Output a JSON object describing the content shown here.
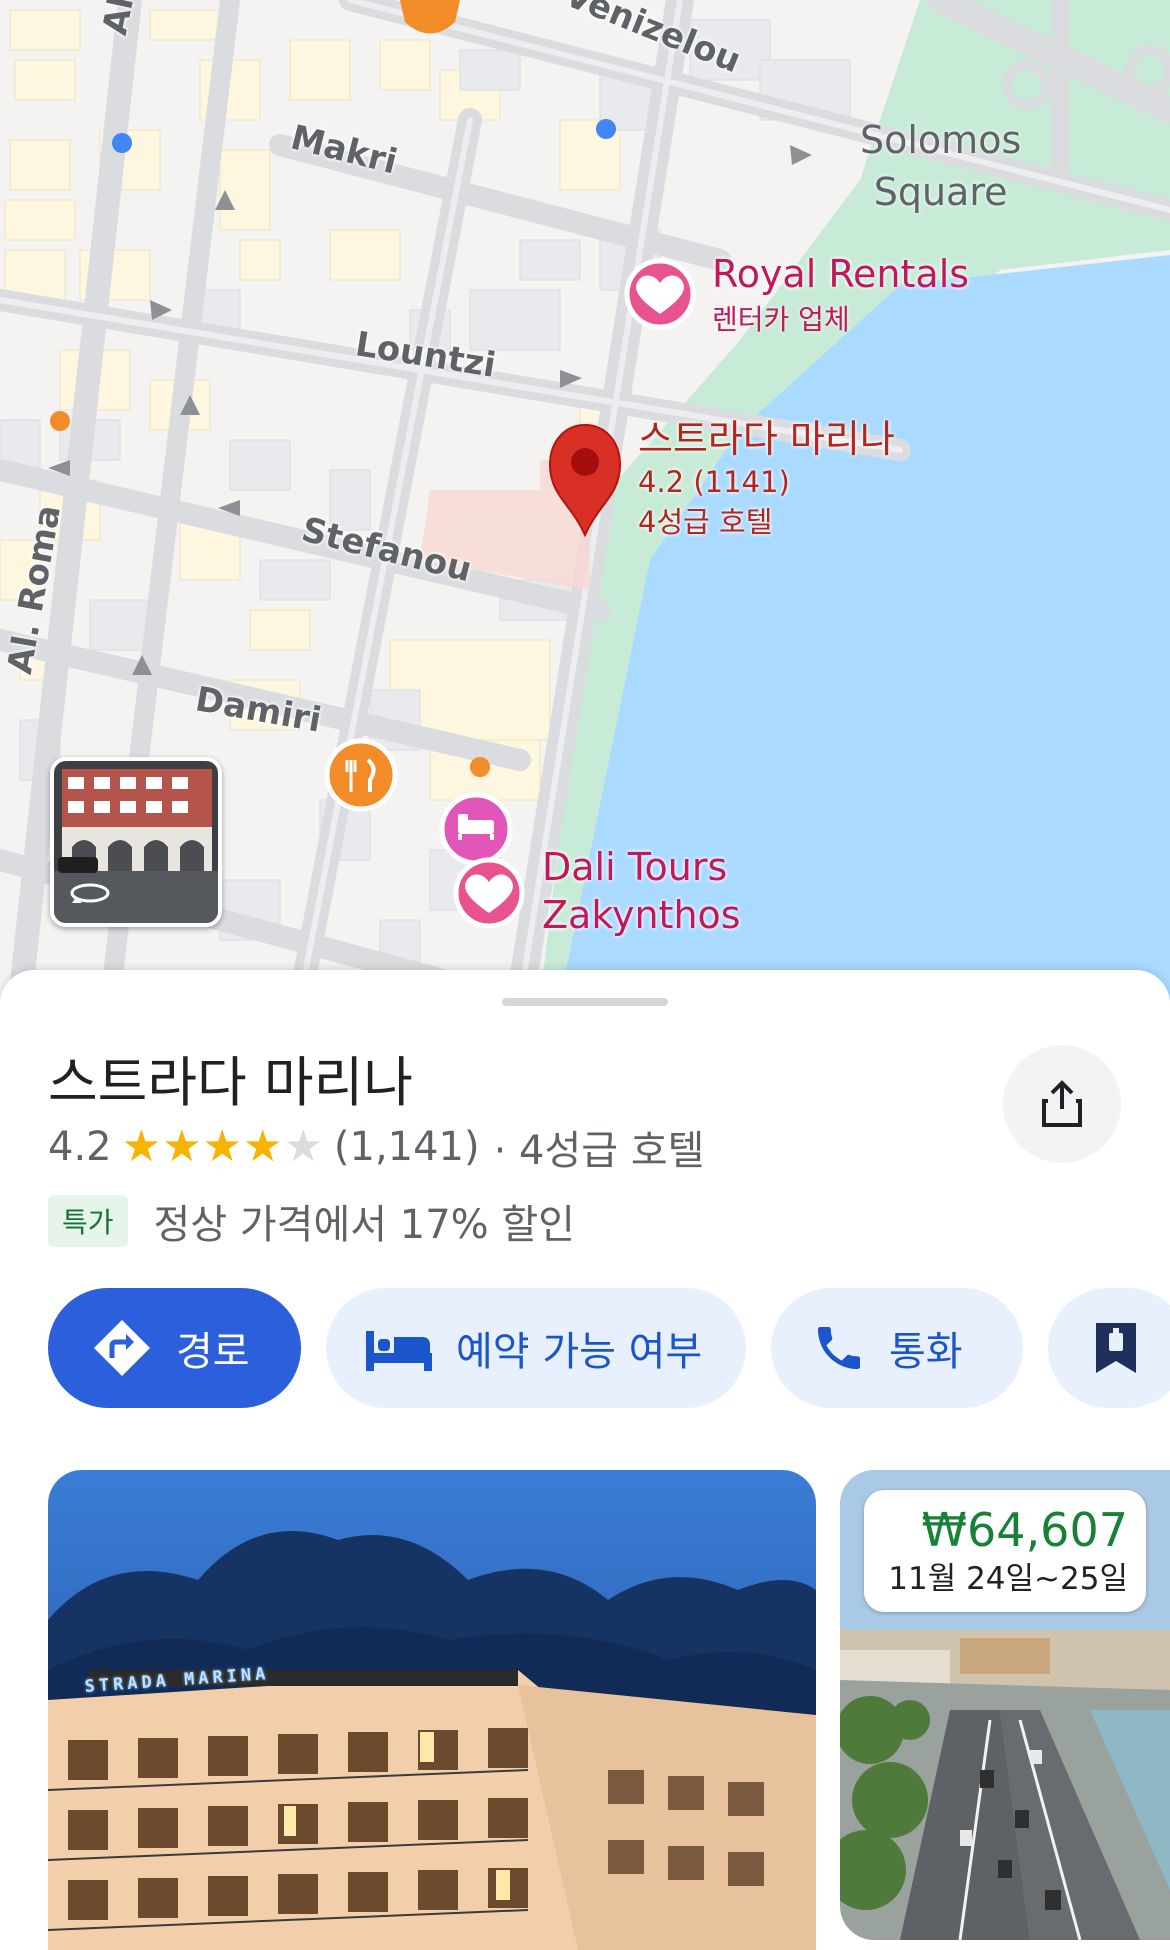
{
  "map": {
    "streets": {
      "venizelou": "Venizelou",
      "al_roma_top": "Al. Ro",
      "makri": "Makri",
      "solomos_line1": "Solomos",
      "solomos_line2": "Square",
      "lountzi": "Lountzi",
      "stefanou": "Stefanou",
      "al_roma_left": "Al. Roma",
      "damiri": "Damiri"
    },
    "pois": {
      "royal_rentals_name": "Royal Rentals",
      "royal_rentals_category": "렌터카 업체",
      "dali_tours_line1": "Dali Tours",
      "dali_tours_line2": "Zakynthos"
    },
    "selected_place": {
      "name": "스트라다 마리나",
      "rating_line": "4.2 (1141)",
      "category": "4성급 호텔"
    }
  },
  "place": {
    "title": "스트라다 마리나",
    "rating": "4.2",
    "stars_value": 4.2,
    "review_count": "(1,141)",
    "category": "· 4성급 호텔",
    "deal_badge": "특가",
    "deal_text": "정상 가격에서 17% 할인"
  },
  "actions": {
    "directions_label": "경로",
    "availability_label": "예약 가능 여부",
    "call_label": "통화"
  },
  "photos": {
    "sign_text": "STRADA MARINA",
    "price": "₩64,607",
    "dates": "11월 24일~25일"
  },
  "colors": {
    "primary_blue": "#2b5fdb",
    "chip_bg": "#e8f0fe",
    "star": "#f6b400",
    "deal_green": "#137333",
    "water": "#aadaff",
    "park": "#c8ebd7",
    "pin_red": "#d93025",
    "poi_pink": "#c2185b"
  },
  "icons": [
    "directions-icon",
    "bed-icon",
    "phone-icon",
    "bookmark-icon",
    "share-icon",
    "restaurant-icon",
    "hotel-icon",
    "heart-icon",
    "street-view-rotate-icon"
  ]
}
